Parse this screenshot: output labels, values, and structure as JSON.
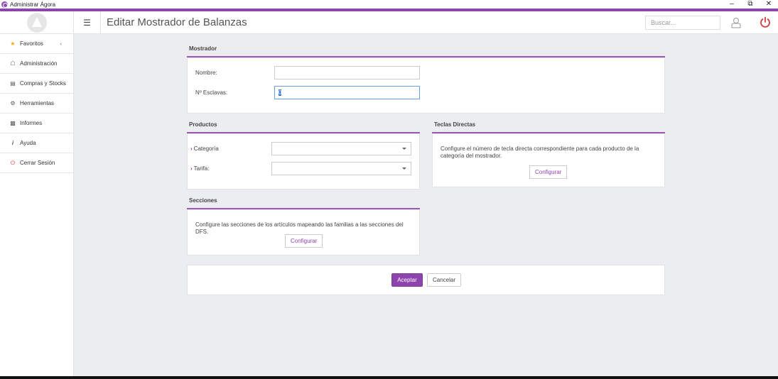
{
  "window": {
    "title": "Administrar Ágora",
    "controls": [
      "minimize",
      "restore",
      "close"
    ]
  },
  "header": {
    "page_title": "Editar Mostrador de Balanzas",
    "search_placeholder": "Buscar..."
  },
  "sidebar": {
    "items": [
      {
        "label": "Favoritos",
        "icon": "star-icon"
      },
      {
        "label": "Administración",
        "icon": "bank-icon"
      },
      {
        "label": "Compras y Stocks",
        "icon": "document-icon"
      },
      {
        "label": "Herramientas",
        "icon": "cogs-icon"
      },
      {
        "label": "Informes",
        "icon": "bar-chart-icon"
      },
      {
        "label": "Ayuda",
        "icon": "info-icon"
      },
      {
        "label": "Cerrar Sesión",
        "icon": "power-icon"
      }
    ]
  },
  "mostrador": {
    "title": "Mostrador",
    "nombre_label": "Nombre:",
    "nombre_value": "",
    "esclavas_label": "Nº Esclavas:",
    "esclavas_value": "0"
  },
  "productos": {
    "title": "Productos",
    "categoria_label": "Categoría",
    "categoria_value": "",
    "tarifa_label": "Tarifa:",
    "tarifa_value": ""
  },
  "teclas": {
    "title": "Teclas Directas",
    "desc_line1": "Configure el número de tecla directa correspondiente para cada producto de la",
    "desc_line2": "categoría del mostrador.",
    "button": "Configurar"
  },
  "secciones": {
    "title": "Secciones",
    "desc": "Configure las secciones de los artículos mapeando las familias a las secciones del DFS.",
    "button": "Configurar"
  },
  "actions": {
    "accept": "Aceptar",
    "cancel": "Cancelar"
  },
  "colors": {
    "accent": "#8e44ad",
    "power": "#d23c3c",
    "star": "#f0a800"
  }
}
